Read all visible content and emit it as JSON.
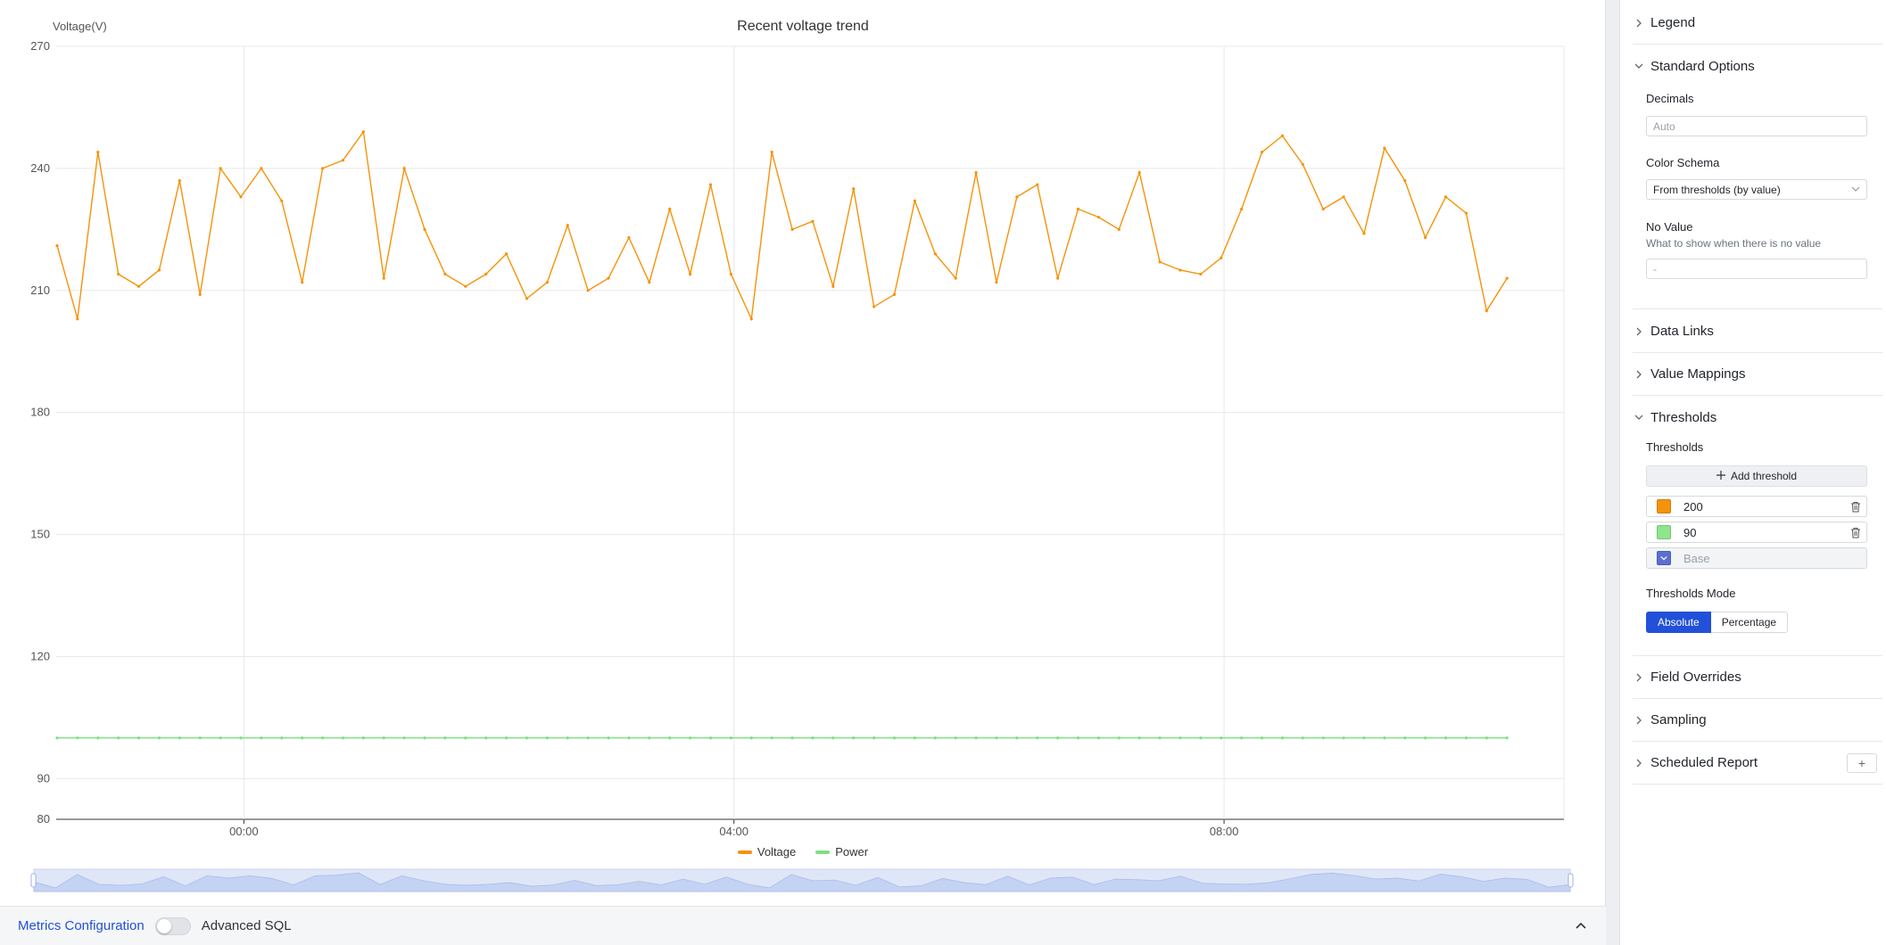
{
  "chart_data": {
    "type": "line",
    "title": "Recent voltage trend",
    "ylabel": "Voltage(V)",
    "xlabel": "",
    "ylim": [
      80,
      270
    ],
    "yticks": [
      270,
      240,
      210,
      180,
      150,
      120,
      90,
      80
    ],
    "xticks": [
      "00:00",
      "04:00",
      "08:00"
    ],
    "grid": true,
    "legend_position": "bottom",
    "series": [
      {
        "name": "Voltage",
        "color": "#f5930a",
        "values": [
          221,
          203,
          244,
          214,
          211,
          215,
          237,
          209,
          240,
          233,
          240,
          232,
          212,
          240,
          242,
          249,
          213,
          240,
          225,
          214,
          211,
          214,
          219,
          208,
          212,
          226,
          210,
          213,
          223,
          212,
          230,
          214,
          236,
          214,
          203,
          244,
          225,
          227,
          211,
          235,
          206,
          209,
          232,
          219,
          213,
          239,
          212,
          233,
          236,
          213,
          230,
          228,
          225,
          239,
          217,
          215,
          214,
          218,
          230,
          244,
          248,
          241,
          230,
          233,
          224,
          245,
          237,
          223,
          233,
          229,
          205,
          213
        ]
      },
      {
        "name": "Power",
        "color": "#7ee07e",
        "values": [
          100,
          100,
          100,
          100,
          100,
          100,
          100,
          100,
          100,
          100,
          100,
          100,
          100,
          100,
          100,
          100,
          100,
          100,
          100,
          100,
          100,
          100,
          100,
          100,
          100,
          100,
          100,
          100,
          100,
          100,
          100,
          100,
          100,
          100,
          100,
          100,
          100,
          100,
          100,
          100,
          100,
          100,
          100,
          100,
          100,
          100,
          100,
          100,
          100,
          100,
          100,
          100,
          100,
          100,
          100,
          100,
          100,
          100,
          100,
          100,
          100,
          100,
          100,
          100,
          100,
          100,
          100,
          100,
          100,
          100,
          100,
          100
        ]
      }
    ]
  },
  "bottom_bar": {
    "metrics_label": "Metrics Configuration",
    "advanced_sql_label": "Advanced SQL",
    "advanced_sql_enabled": false
  },
  "sidebar": {
    "legend": "Legend",
    "standard_options": "Standard Options",
    "decimals_label": "Decimals",
    "decimals_placeholder": "Auto",
    "color_schema_label": "Color Schema",
    "color_schema_value": "From thresholds (by value)",
    "no_value_label": "No Value",
    "no_value_hint": "What to show when there is no value",
    "no_value_placeholder": "-",
    "data_links": "Data Links",
    "value_mappings": "Value Mappings",
    "thresholds": "Thresholds",
    "thresholds_label": "Thresholds",
    "add_threshold": "Add threshold",
    "threshold_rows": [
      {
        "value": "200",
        "color": "#f5930a"
      },
      {
        "value": "90",
        "color": "#8ee58e"
      },
      {
        "value": "Base",
        "color": "#5b6fd3"
      }
    ],
    "thresholds_mode_label": "Thresholds Mode",
    "mode_absolute": "Absolute",
    "mode_percentage": "Percentage",
    "field_overrides": "Field Overrides",
    "sampling": "Sampling",
    "scheduled_report": "Scheduled Report",
    "scheduled_report_add": "+"
  }
}
